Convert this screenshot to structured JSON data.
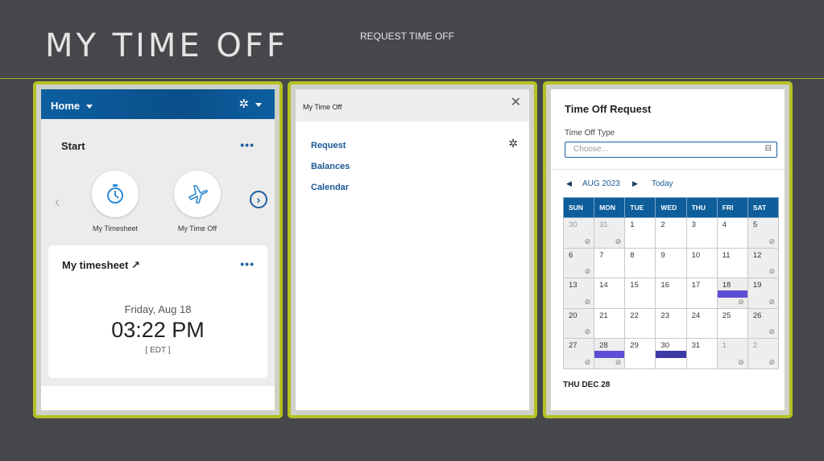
{
  "page": {
    "title": "MY TIME OFF",
    "subtitle": "REQUEST TIME OFF"
  },
  "panel1": {
    "home_label": "Home",
    "start_label": "Start",
    "more_label": "•••",
    "shortcuts": [
      {
        "label": "My Timesheet",
        "icon": "stopwatch-icon"
      },
      {
        "label": "My Time Off",
        "icon": "airplane-icon"
      }
    ],
    "timesheet_title": "My timesheet ↗",
    "date": "Friday, Aug 18",
    "time": "03:22 PM",
    "zone": "[ EDT ]"
  },
  "panel2": {
    "title": "My Time Off",
    "links": [
      "Request",
      "Balances",
      "Calendar"
    ]
  },
  "panel3": {
    "title": "Time Off Request",
    "type_label": "Time Off Type",
    "type_placeholder": "Choose...",
    "month": "AUG 2023",
    "today": "Today",
    "weekdays": [
      "SUN",
      "MON",
      "TUE",
      "WED",
      "THU",
      "FRI",
      "SAT"
    ],
    "weeks": [
      [
        {
          "d": "30",
          "m": true,
          "g": true
        },
        {
          "d": "31",
          "m": true,
          "g": true
        },
        {
          "d": "1"
        },
        {
          "d": "2"
        },
        {
          "d": "3"
        },
        {
          "d": "4"
        },
        {
          "d": "5",
          "g": true
        }
      ],
      [
        {
          "d": "6",
          "g": true
        },
        {
          "d": "7"
        },
        {
          "d": "8"
        },
        {
          "d": "9"
        },
        {
          "d": "10"
        },
        {
          "d": "11"
        },
        {
          "d": "12",
          "g": true
        }
      ],
      [
        {
          "d": "13",
          "g": true
        },
        {
          "d": "14"
        },
        {
          "d": "15"
        },
        {
          "d": "16"
        },
        {
          "d": "17"
        },
        {
          "d": "18",
          "g": true,
          "bar": "light"
        },
        {
          "d": "19",
          "g": true
        }
      ],
      [
        {
          "d": "20",
          "g": true
        },
        {
          "d": "21"
        },
        {
          "d": "22"
        },
        {
          "d": "23"
        },
        {
          "d": "24"
        },
        {
          "d": "25"
        },
        {
          "d": "26",
          "g": true
        }
      ],
      [
        {
          "d": "27",
          "g": true
        },
        {
          "d": "28",
          "g": true,
          "bar": "light"
        },
        {
          "d": "29"
        },
        {
          "d": "30",
          "bar": "dark"
        },
        {
          "d": "31"
        },
        {
          "d": "1",
          "m": true,
          "g": true
        },
        {
          "d": "2",
          "m": true,
          "g": true
        }
      ]
    ],
    "selected_date": "THU DEC 28",
    "colors": {
      "bar_light": "#5c4fd6",
      "bar_dark": "#3d3aa8",
      "header": "#0d5e9a"
    }
  }
}
